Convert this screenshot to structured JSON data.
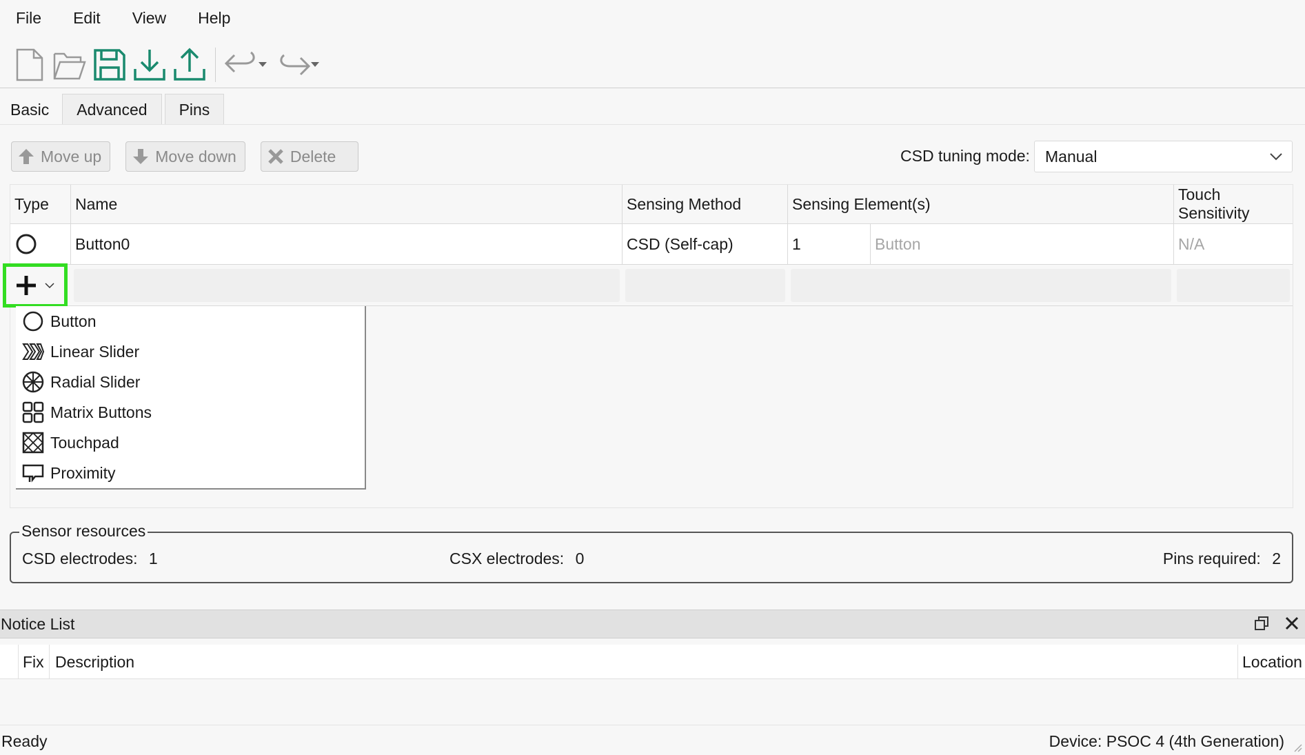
{
  "menu": [
    "File",
    "Edit",
    "View",
    "Help"
  ],
  "toolbar": {
    "icons": [
      "new-file-icon",
      "open-folder-icon",
      "save-icon",
      "import-icon",
      "export-icon",
      "undo-icon",
      "redo-icon"
    ],
    "accent": "#1a8a6e"
  },
  "tabs": [
    "Basic",
    "Advanced",
    "Pins"
  ],
  "actions": {
    "move_up": "Move up",
    "move_down": "Move down",
    "delete": "Delete"
  },
  "tuning": {
    "label": "CSD tuning mode:",
    "value": "Manual"
  },
  "table": {
    "headers": [
      "Type",
      "Name",
      "Sensing Method",
      "Sensing Element(s)",
      "Touch Sensitivity"
    ],
    "rows": [
      {
        "type_icon": "button-circle-icon",
        "name": "Button0",
        "method": "CSD (Self-cap)",
        "element_count": "1",
        "element_name": "Button",
        "sensitivity": "N/A"
      }
    ]
  },
  "dropdown": {
    "items": [
      {
        "label": "Button",
        "icon": "button-circle-icon"
      },
      {
        "label": "Linear Slider",
        "icon": "linear-slider-icon"
      },
      {
        "label": "Radial Slider",
        "icon": "radial-slider-icon"
      },
      {
        "label": "Matrix Buttons",
        "icon": "matrix-buttons-icon"
      },
      {
        "label": "Touchpad",
        "icon": "touchpad-icon"
      },
      {
        "label": "Proximity",
        "icon": "proximity-icon"
      }
    ]
  },
  "sensor_resources": {
    "title": "Sensor resources",
    "csd_label": "CSD electrodes:",
    "csd_value": "1",
    "csx_label": "CSX electrodes:",
    "csx_value": "0",
    "pins_label": "Pins required:",
    "pins_value": "2"
  },
  "notice": {
    "title": "Notice List",
    "columns": [
      "Fix",
      "Description",
      "Location"
    ]
  },
  "status": {
    "left": "Ready",
    "right": "Device: PSOC 4 (4th Generation)"
  },
  "colors": {
    "highlight": "#33dd22"
  }
}
